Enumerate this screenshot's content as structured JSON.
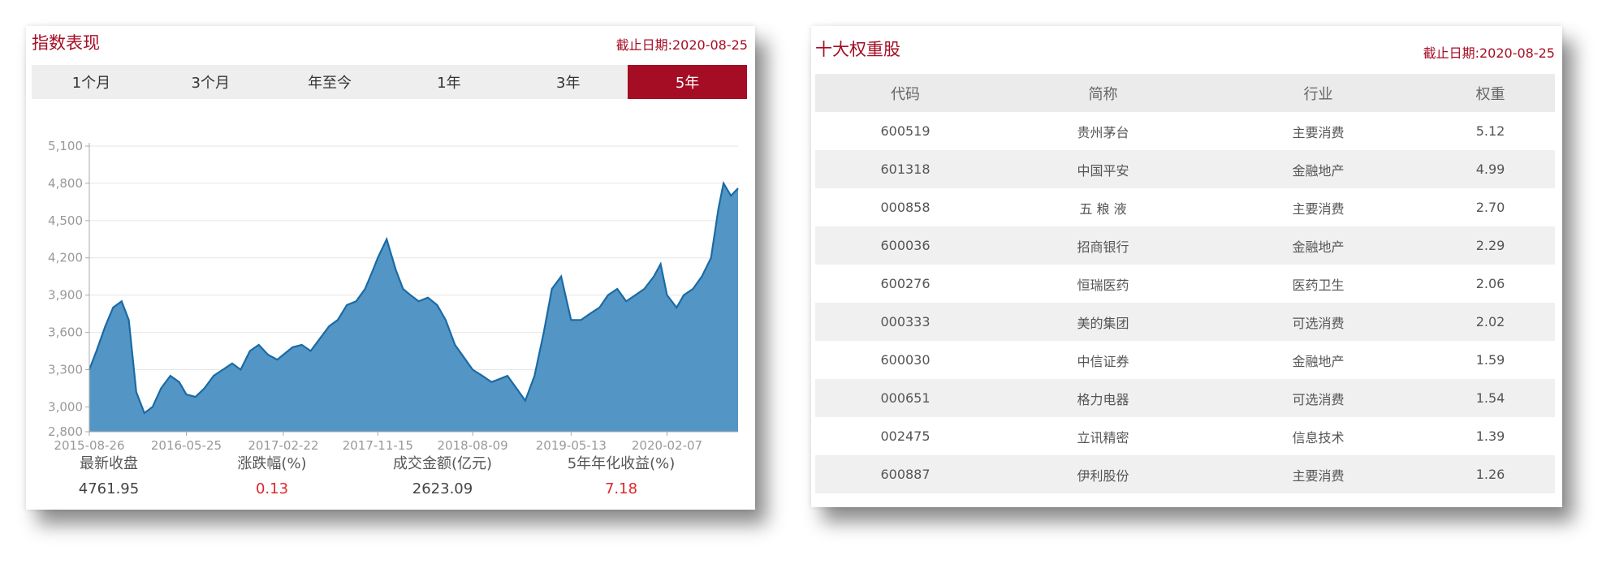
{
  "index_panel": {
    "title": "指数表现",
    "cutoff": "截止日期:2020-08-25",
    "tabs": [
      "1个月",
      "3个月",
      "年至今",
      "1年",
      "3年",
      "5年"
    ],
    "active_tab": 5,
    "accent_color": "#a50d24",
    "stats": [
      {
        "label": "最新收盘",
        "value": "4761.95",
        "color": "#444444"
      },
      {
        "label": "涨跌幅(%)",
        "value": "0.13",
        "color": "#e0262b"
      },
      {
        "label": "成交金额(亿元)",
        "value": "2623.09",
        "color": "#444444"
      },
      {
        "label": "5年年化收益(%)",
        "value": "7.18",
        "color": "#e0262b"
      }
    ]
  },
  "chart_data": {
    "type": "area",
    "title": "",
    "xlabel": "",
    "ylabel": "",
    "ylim": [
      2800,
      5100
    ],
    "y_ticks": [
      "2,800",
      "3,000",
      "3,300",
      "3,600",
      "3,900",
      "4,200",
      "4,500",
      "4,800",
      "5,100"
    ],
    "x_ticks": [
      "2015-08-26",
      "2016-05-25",
      "2017-02-22",
      "2017-11-15",
      "2018-08-09",
      "2019-05-13",
      "2020-02-07"
    ],
    "grid": true,
    "fill_color": "#4a90c2",
    "line_color": "#1a6aa5",
    "series": [
      {
        "x": [
          "2015-08-26",
          "2015-09-15",
          "2015-10-10",
          "2015-11-01",
          "2015-11-25",
          "2015-12-15",
          "2016-01-05",
          "2016-01-28",
          "2016-02-20",
          "2016-03-15",
          "2016-04-10",
          "2016-05-05",
          "2016-05-25",
          "2016-06-20",
          "2016-07-15",
          "2016-08-10",
          "2016-09-05",
          "2016-10-01",
          "2016-10-25",
          "2016-11-20",
          "2016-12-15",
          "2017-01-10",
          "2017-02-05",
          "2017-02-22",
          "2017-03-20",
          "2017-04-15",
          "2017-05-10",
          "2017-06-05",
          "2017-07-01",
          "2017-07-25",
          "2017-08-20",
          "2017-09-15",
          "2017-10-10",
          "2017-11-01",
          "2017-11-15",
          "2017-12-10",
          "2018-01-05",
          "2018-01-25",
          "2018-02-15",
          "2018-03-10",
          "2018-04-05",
          "2018-05-01",
          "2018-05-25",
          "2018-06-20",
          "2018-07-15",
          "2018-08-09",
          "2018-09-05",
          "2018-10-01",
          "2018-10-20",
          "2018-11-15",
          "2018-12-10",
          "2019-01-04",
          "2019-01-30",
          "2019-02-25",
          "2019-03-20",
          "2019-04-15",
          "2019-05-13",
          "2019-06-10",
          "2019-07-05",
          "2019-08-01",
          "2019-08-25",
          "2019-09-20",
          "2019-10-15",
          "2019-11-10",
          "2019-12-05",
          "2020-01-01",
          "2020-01-20",
          "2020-02-07",
          "2020-03-05",
          "2020-03-25",
          "2020-04-20",
          "2020-05-15",
          "2020-06-10",
          "2020-07-01",
          "2020-07-15",
          "2020-08-05",
          "2020-08-25"
        ],
        "values": [
          3300,
          3450,
          3650,
          3800,
          3850,
          3700,
          3120,
          2950,
          3000,
          3150,
          3250,
          3200,
          3100,
          3080,
          3150,
          3250,
          3300,
          3350,
          3300,
          3450,
          3500,
          3420,
          3380,
          3420,
          3480,
          3500,
          3450,
          3550,
          3650,
          3700,
          3820,
          3850,
          3950,
          4100,
          4200,
          4350,
          4100,
          3950,
          3900,
          3850,
          3880,
          3820,
          3700,
          3500,
          3400,
          3300,
          3250,
          3200,
          3220,
          3250,
          3150,
          3050,
          3250,
          3600,
          3950,
          4050,
          3700,
          3700,
          3750,
          3800,
          3900,
          3950,
          3850,
          3900,
          3950,
          4050,
          4150,
          3900,
          3800,
          3900,
          3950,
          4050,
          4200,
          4600,
          4800,
          4700,
          4760
        ]
      }
    ]
  },
  "weights_panel": {
    "title": "十大权重股",
    "cutoff": "截止日期:2020-08-25",
    "columns": [
      "代码",
      "简称",
      "行业",
      "权重"
    ],
    "rows": [
      [
        "600519",
        "贵州茅台",
        "主要消费",
        "5.12"
      ],
      [
        "601318",
        "中国平安",
        "金融地产",
        "4.99"
      ],
      [
        "000858",
        "五 粮 液",
        "主要消费",
        "2.70"
      ],
      [
        "600036",
        "招商银行",
        "金融地产",
        "2.29"
      ],
      [
        "600276",
        "恒瑞医药",
        "医药卫生",
        "2.06"
      ],
      [
        "000333",
        "美的集团",
        "可选消费",
        "2.02"
      ],
      [
        "600030",
        "中信证券",
        "金融地产",
        "1.59"
      ],
      [
        "000651",
        "格力电器",
        "可选消费",
        "1.54"
      ],
      [
        "002475",
        "立讯精密",
        "信息技术",
        "1.39"
      ],
      [
        "600887",
        "伊利股份",
        "主要消费",
        "1.26"
      ]
    ]
  }
}
